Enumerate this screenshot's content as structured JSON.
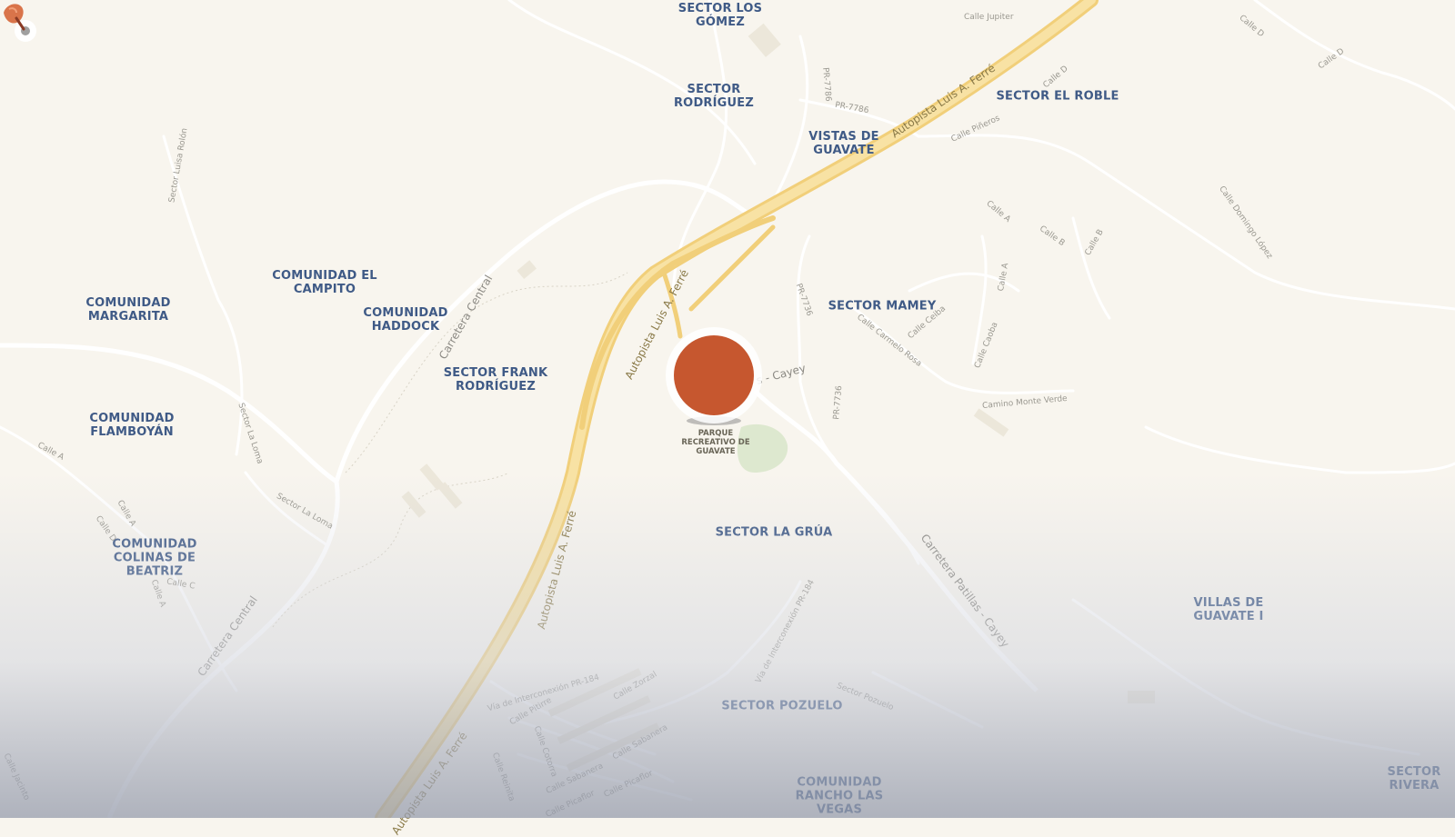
{
  "map": {
    "colors": {
      "background": "#f8f5ee",
      "highway": "#f6d98a",
      "place_label": "#3f5a86",
      "marker": "#c6572f",
      "park": "#dde8cf"
    },
    "places": [
      {
        "id": "sector-los-gomez",
        "label": "SECTOR LOS\nGÓMEZ"
      },
      {
        "id": "sector-rodriguez",
        "label": "SECTOR\nRODRÍGUEZ"
      },
      {
        "id": "sector-el-roble",
        "label": "SECTOR EL ROBLE"
      },
      {
        "id": "vistas-de-guavate",
        "label": "VISTAS DE\nGUAVATE"
      },
      {
        "id": "comunidad-el-campito",
        "label": "COMUNIDAD EL\nCAMPITO"
      },
      {
        "id": "comunidad-margarita",
        "label": "COMUNIDAD\nMARGARITA"
      },
      {
        "id": "comunidad-haddock",
        "label": "COMUNIDAD\nHADDOCK"
      },
      {
        "id": "sector-mamey",
        "label": "SECTOR MAMEY"
      },
      {
        "id": "sector-frank-rodriguez",
        "label": "SECTOR FRANK\nRODRÍGUEZ"
      },
      {
        "id": "comunidad-flamboyan",
        "label": "COMUNIDAD\nFLAMBOYÁN"
      },
      {
        "id": "sector-la-grua",
        "label": "SECTOR LA GRÚA"
      },
      {
        "id": "comunidad-colinas-de-beatriz",
        "label": "COMUNIDAD\nCOLINAS DE\nBEATRIZ"
      },
      {
        "id": "villas-de-guavate-i",
        "label": "VILLAS DE\nGUAVATE I"
      },
      {
        "id": "sector-pozuelo",
        "label": "SECTOR POZUELO"
      },
      {
        "id": "comunidad-rancho-las-vegas",
        "label": "COMUNIDAD\nRANCHO LAS\nVEGAS"
      },
      {
        "id": "sector-rivera",
        "label": "SECTOR RIVERA"
      }
    ],
    "highway_labels": [
      "Autopista Luis A. Ferré",
      "Autopista Luis A. Ferré",
      "Autopista Luis A. Ferré",
      "Autopista Luis A. Ferré"
    ],
    "road_labels": [
      "Carretera Central",
      "Carretera Central",
      "Carretera Patillas - Cayey"
    ],
    "street_labels": [
      "Calle Jupiter",
      "Calle D",
      "Calle D",
      "Calle D",
      "PR-7786",
      "PR-7786",
      "Calle Piñeros",
      "PR-7736",
      "PR-7736",
      "Calle A",
      "Calle B",
      "Calle B",
      "Calle Domingo López",
      "Calle A",
      "Calle Ceiba",
      "Calle Carmelo Rosa",
      "Calle Caoba",
      "Camino Monte Verde",
      "Sector Luisa Rolón",
      "Sector La Loma",
      "Sector La Loma",
      "Calle A",
      "Calle A",
      "Calle D",
      "Calle A",
      "Calle C",
      "Vía de Interconexión PR-184",
      "Vía de Interconexión PR-184",
      "Sector Pozuelo",
      "Calle Zorzal",
      "Calle Pitirre",
      "Calle Cotorra",
      "Calle Sabanera",
      "Calle Sabanera",
      "Calle Reinita",
      "Calle Picaflor",
      "Calle Picaflor",
      "Calle Jacinto"
    ],
    "poi": {
      "name": "PARQUE RECREATIVO DE GUAVATE",
      "icon": "location-pin-icon"
    },
    "partial_label": "s - Cayey"
  }
}
